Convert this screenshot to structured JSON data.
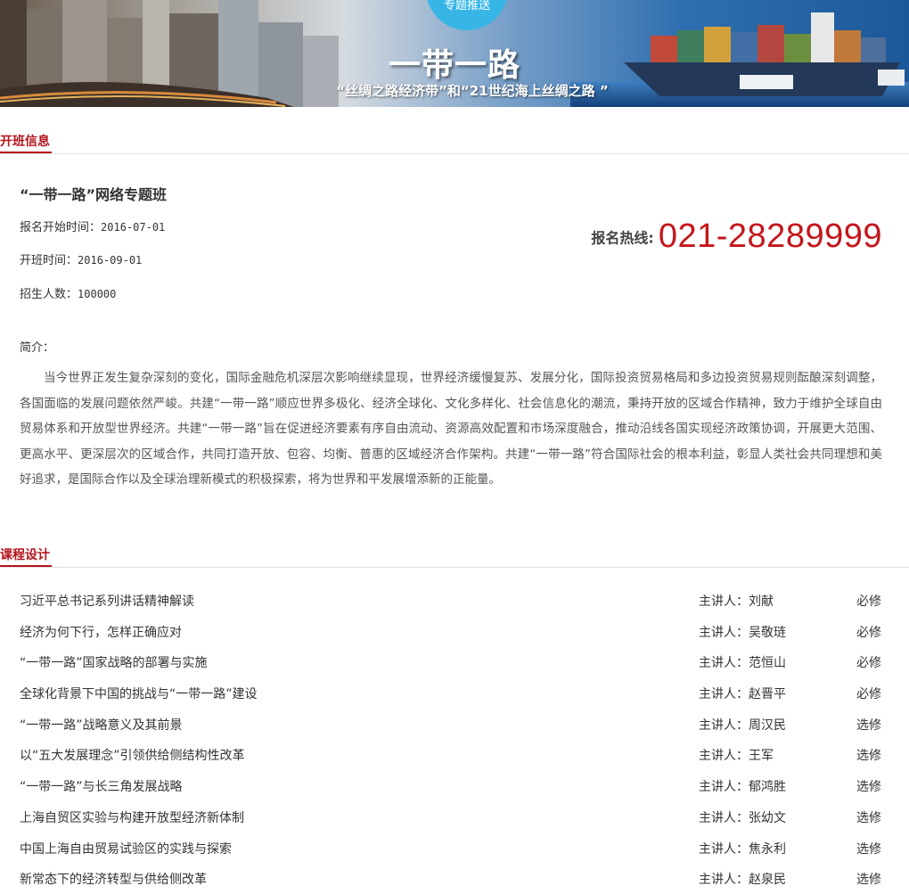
{
  "banner": {
    "badge": "专题推送",
    "title": "一带一路",
    "subtitle": "“丝绸之路经济带”和“21世纪海上丝绸之路 ”"
  },
  "class_info": {
    "section_label": "开班信息",
    "title": "“一带一路”网络专题班",
    "signup_start": {
      "label": "报名开始时间：",
      "value": "2016-07-01"
    },
    "class_start": {
      "label": "开班时间：",
      "value": "2016-09-01"
    },
    "enrollment": {
      "label": "招生人数：",
      "value": "100000"
    },
    "hotline": {
      "label": "报名热线:",
      "number": "021-28289999"
    },
    "intro_label": "简介：",
    "intro_text": "当今世界正发生复杂深刻的变化，国际金融危机深层次影响继续显现，世界经济缓慢复苏、发展分化，国际投资贸易格局和多边投资贸易规则酝酿深刻调整，各国面临的发展问题依然严峻。共建“一带一路”顺应世界多极化、经济全球化、文化多样化、社会信息化的潮流，秉持开放的区域合作精神，致力于维护全球自由贸易体系和开放型世界经济。共建“一带一路”旨在促进经济要素有序自由流动、资源高效配置和市场深度融合，推动沿线各国实现经济政策协调，开展更大范围、更高水平、更深层次的区域合作，共同打造开放、包容、均衡、普惠的区域经济合作架构。共建“一带一路”符合国际社会的根本利益，彰显人类社会共同理想和美好追求，是国际合作以及全球治理新模式的积极探索，将为世界和平发展增添新的正能量。"
  },
  "courses": {
    "section_label": "课程设计",
    "items": [
      {
        "title": "习近平总书记系列讲话精神解读",
        "teacher": "主讲人：刘献",
        "type": "必修"
      },
      {
        "title": "经济为何下行，怎样正确应对",
        "teacher": "主讲人：吴敬琏",
        "type": "必修"
      },
      {
        "title": "“一带一路”国家战略的部署与实施",
        "teacher": "主讲人：范恒山",
        "type": "必修"
      },
      {
        "title": "全球化背景下中国的挑战与“一带一路”建设",
        "teacher": "主讲人：赵晋平",
        "type": "必修"
      },
      {
        "title": "“一带一路”战略意义及其前景",
        "teacher": "主讲人：周汉民",
        "type": "选修"
      },
      {
        "title": "以“五大发展理念”引领供给侧结构性改革",
        "teacher": "主讲人：王军",
        "type": "选修"
      },
      {
        "title": "“一带一路”与长三角发展战略",
        "teacher": "主讲人：郁鸿胜",
        "type": "选修"
      },
      {
        "title": "上海自贸区实验与构建开放型经济新体制",
        "teacher": "主讲人：张幼文",
        "type": "选修"
      },
      {
        "title": "中国上海自由贸易试验区的实践与探索",
        "teacher": "主讲人：焦永利",
        "type": "选修"
      },
      {
        "title": "新常态下的经济转型与供给侧改革",
        "teacher": "主讲人：赵泉民",
        "type": "选修"
      }
    ]
  }
}
